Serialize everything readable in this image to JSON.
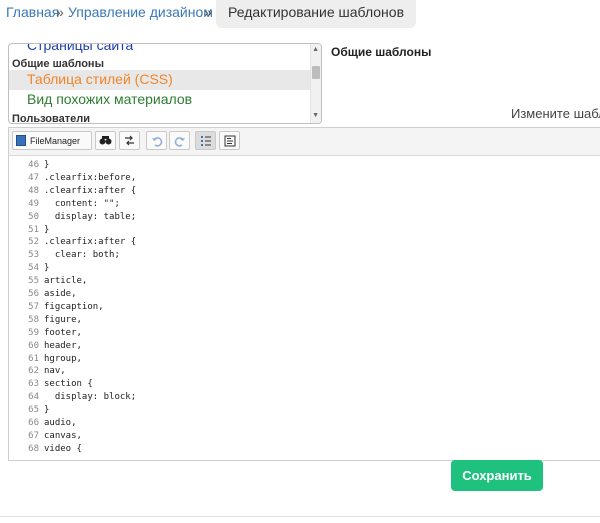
{
  "breadcrumb": {
    "home": "Главная",
    "separator": "»",
    "design": "Управление дизайном",
    "current": "Редактирование шаблонов"
  },
  "templates": {
    "page_item": "Страницы сайта",
    "group_general": "Общие шаблоны",
    "css_item": "Таблица стилей (CSS)",
    "similar_item": "Вид похожих материалов",
    "group_users": "Пользователи"
  },
  "section_title": "Общие шаблоны",
  "change_text": "Измените шабл",
  "toolbar": {
    "filemanager_label": "FileManager",
    "icons": [
      "search-icon",
      "replace-icon",
      "undo-icon",
      "redo-icon",
      "line-numbers-icon",
      "preview-icon"
    ]
  },
  "editor": {
    "lines": [
      {
        "n": "46",
        "code": "}"
      },
      {
        "n": "47",
        "code": ".clearfix:before,"
      },
      {
        "n": "48",
        "code": ".clearfix:after {"
      },
      {
        "n": "49",
        "code": "  content: \"\";"
      },
      {
        "n": "50",
        "code": "  display: table;"
      },
      {
        "n": "51",
        "code": "}"
      },
      {
        "n": "52",
        "code": ".clearfix:after {"
      },
      {
        "n": "53",
        "code": "  clear: both;"
      },
      {
        "n": "54",
        "code": "}"
      },
      {
        "n": "55",
        "code": "article,"
      },
      {
        "n": "56",
        "code": "aside,"
      },
      {
        "n": "57",
        "code": "figcaption,"
      },
      {
        "n": "58",
        "code": "figure,"
      },
      {
        "n": "59",
        "code": "footer,"
      },
      {
        "n": "60",
        "code": "header,"
      },
      {
        "n": "61",
        "code": "hgroup,"
      },
      {
        "n": "62",
        "code": "nav,"
      },
      {
        "n": "63",
        "code": "section {"
      },
      {
        "n": "64",
        "code": "  display: block;"
      },
      {
        "n": "65",
        "code": "}"
      },
      {
        "n": "66",
        "code": "audio,"
      },
      {
        "n": "67",
        "code": "canvas,"
      },
      {
        "n": "68",
        "code": "video {"
      }
    ]
  },
  "save_button": "Сохранить",
  "colors": {
    "link": "#3a78b9",
    "accent_orange": "#f0852b",
    "green_item": "#2e7d32",
    "save_green": "#1fc17e"
  }
}
